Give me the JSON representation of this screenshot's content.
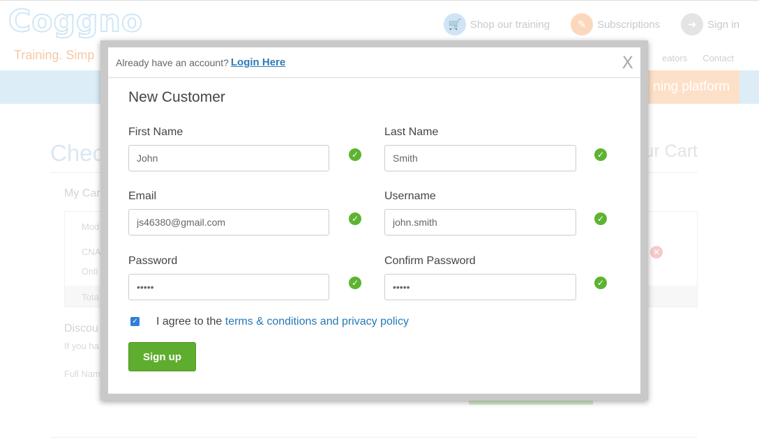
{
  "background": {
    "logo": "Coggno",
    "tagline": "Training. Simp",
    "nav": {
      "shop": "Shop our training",
      "subscriptions": "Subscriptions",
      "sign_in": "Sign in"
    },
    "sub_nav": {
      "creators": "eators",
      "contact": "Contact"
    },
    "banner_cta": "ning platform",
    "checkout_title": "Chec",
    "cart_title": "ur Cart",
    "my_cart": "My Car",
    "col_mod": "Mod",
    "row_cna": "CNA",
    "row_onli": "Onli",
    "row_total": "Tota",
    "discount": "Discou",
    "discount_hint": "If you ha",
    "full_name": "Full Nam"
  },
  "modal": {
    "header_text": "Already have an account?",
    "login_link": "Login Here",
    "close_label": "X",
    "title": "New Customer",
    "fields": {
      "first_name": {
        "label": "First Name",
        "value": "John"
      },
      "last_name": {
        "label": "Last Name",
        "value": "Smith"
      },
      "email": {
        "label": "Email",
        "value": "js46380@gmail.com"
      },
      "username": {
        "label": "Username",
        "value": "john.smith"
      },
      "password": {
        "label": "Password",
        "value": "•••••"
      },
      "confirm_password": {
        "label": "Confirm Password",
        "value": "•••••"
      }
    },
    "agree_prefix": "I agree to the",
    "agree_link": "terms & conditions and privacy policy",
    "agree_checked": true,
    "signup_label": "Sign up"
  },
  "colors": {
    "primary_green": "#5fad2e",
    "link_blue": "#2578b5",
    "valid_green": "#5cb431"
  }
}
